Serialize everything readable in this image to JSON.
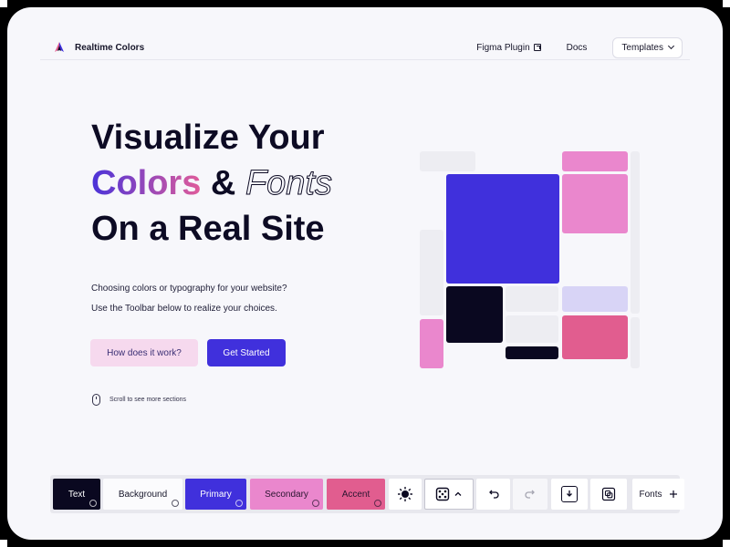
{
  "header": {
    "brand": "Realtime Colors",
    "nav": {
      "figma": "Figma Plugin",
      "docs": "Docs",
      "templates": "Templates"
    }
  },
  "hero": {
    "line1": "Visualize Your",
    "colors_word": "Colors",
    "amp": "&",
    "fonts_word": "Fonts",
    "line3": "On a Real Site",
    "para1": "Choosing colors or typography for your website?",
    "para2": "Use the Toolbar below to realize your choices.",
    "btn_secondary": "How does it work?",
    "btn_primary": "Get Started",
    "scroll_hint": "Scroll to see more sections"
  },
  "toolbar": {
    "text": "Text",
    "background": "Background",
    "primary": "Primary",
    "secondary": "Secondary",
    "accent": "Accent",
    "fonts": "Fonts"
  },
  "colors": {
    "text": "#0a0820",
    "background": "#f7f7fb",
    "primary": "#4030dc",
    "secondary": "#ea87cd",
    "accent": "#e15d8f"
  },
  "icons": [
    "logo-icon",
    "external-link-icon",
    "chevron-down-icon",
    "mouse-icon",
    "sun-icon",
    "dice-icon",
    "chevron-up-icon",
    "undo-icon",
    "redo-icon",
    "download-icon",
    "copy-icon",
    "plus-icon"
  ]
}
